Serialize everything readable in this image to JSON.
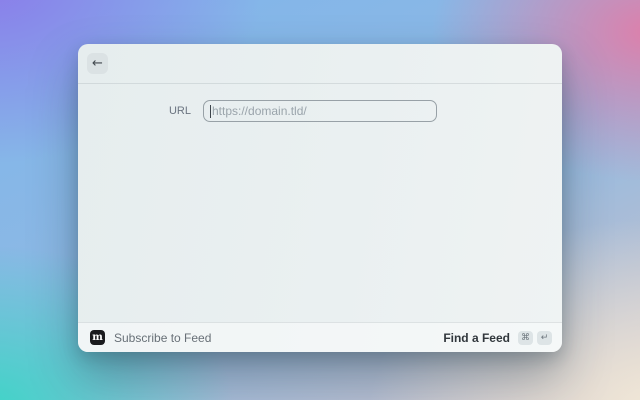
{
  "window": {
    "header": {
      "back_icon": "←"
    },
    "form": {
      "url_label": "URL",
      "url_value": "",
      "url_placeholder": "https://domain.tld/"
    },
    "footer": {
      "app_icon_letter": "m",
      "command_title": "Subscribe to Feed",
      "primary_action_label": "Find a Feed",
      "shortcut_keys": [
        "⌘",
        "↵"
      ]
    }
  },
  "colors": {
    "background_purple": "#8b7ce9",
    "background_blue": "#7fb5ec",
    "background_pink": "#e27ca7",
    "background_teal": "#3fd4c7",
    "background_cream": "#f3ead8",
    "panel": "#e9eff0",
    "app_icon_bg": "#1a1b1e",
    "input_border": "#98a1a7",
    "placeholder_text": "#9aa4ab"
  }
}
